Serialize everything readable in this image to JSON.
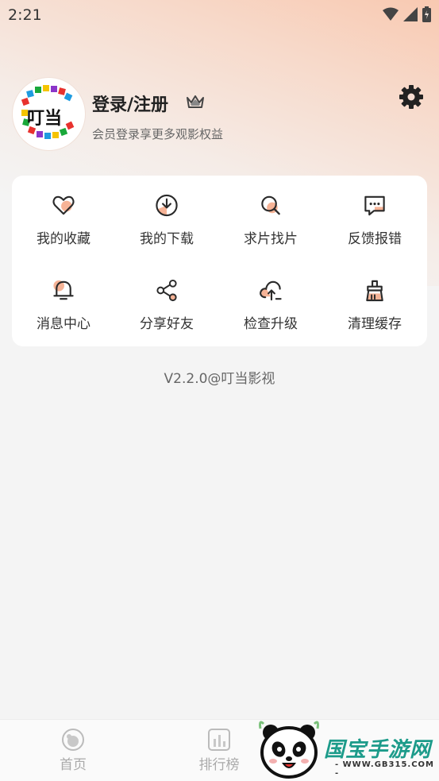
{
  "status_bar": {
    "time": "2:21"
  },
  "profile": {
    "avatar_text": "叮当",
    "title": "登录/注册",
    "subtitle": "会员登录享更多观影权益"
  },
  "menu": {
    "items": [
      {
        "label": "我的收藏",
        "icon": "heart-icon"
      },
      {
        "label": "我的下载",
        "icon": "download-icon"
      },
      {
        "label": "求片找片",
        "icon": "search-icon"
      },
      {
        "label": "反馈报错",
        "icon": "feedback-icon"
      },
      {
        "label": "消息中心",
        "icon": "bell-icon"
      },
      {
        "label": "分享好友",
        "icon": "share-icon"
      },
      {
        "label": "检查升级",
        "icon": "upgrade-icon"
      },
      {
        "label": "清理缓存",
        "icon": "broom-icon"
      }
    ]
  },
  "version": "V2.2.0@叮当影视",
  "bottom_nav": {
    "home": "首页",
    "ranking": "排行榜"
  },
  "watermark": {
    "brand": "国宝手游网",
    "url": "- WWW.GB315.COM -"
  },
  "colors": {
    "accent": "#f6a98a",
    "icon_stroke": "#2a2a2a",
    "watermark": "#1c9b8a"
  }
}
